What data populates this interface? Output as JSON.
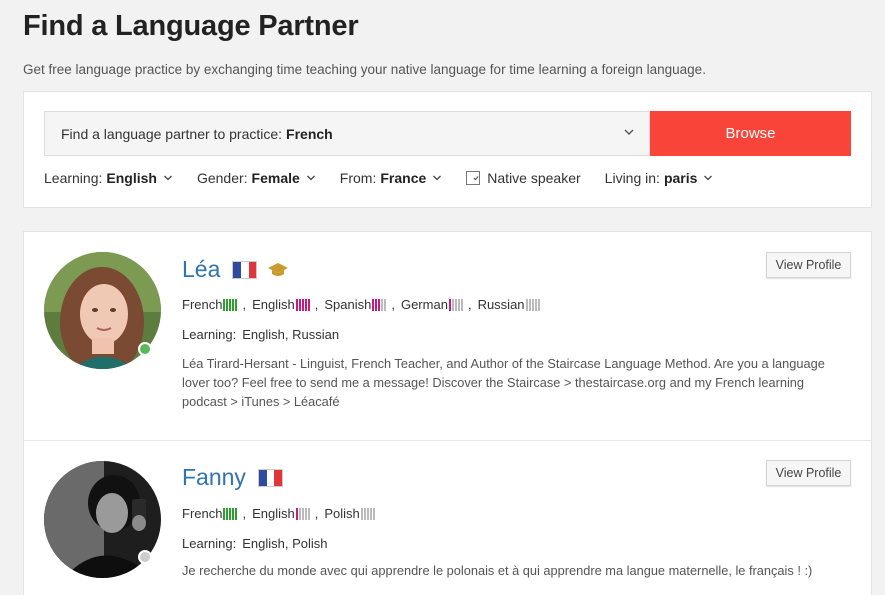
{
  "header": {
    "title": "Find a Language Partner",
    "subtitle": "Get free language practice by exchanging time teaching your native language for time learning a foreign language."
  },
  "search": {
    "prompt": "Find a language partner to practice:",
    "language": "French",
    "browse_label": "Browse"
  },
  "filters": {
    "learning_label": "Learning:",
    "learning_value": "English",
    "gender_label": "Gender:",
    "gender_value": "Female",
    "from_label": "From:",
    "from_value": "France",
    "native_label": "Native speaker",
    "native_checked": true,
    "living_label": "Living in:",
    "living_value": "paris"
  },
  "colors": {
    "accent": "#f94439",
    "link": "#2f74b3",
    "bar_native": "#2e9e2e",
    "bar_learning": "#c8197c",
    "bar_empty": "#bbbbbb",
    "online": "#5cb85c",
    "offline": "#cccccc"
  },
  "profiles": [
    {
      "name": "Léa",
      "flag": "france-flag",
      "badge_icon": "graduation-cap-icon",
      "status": "online",
      "view_label": "View Profile",
      "languages": [
        {
          "name": "French",
          "level": 5,
          "native": true
        },
        {
          "name": "English",
          "level": 5,
          "native": false
        },
        {
          "name": "Spanish",
          "level": 3,
          "native": false
        },
        {
          "name": "German",
          "level": 1,
          "native": false
        },
        {
          "name": "Russian",
          "level": 0,
          "native": false
        }
      ],
      "learning_label": "Learning:",
      "learning": "English,  Russian",
      "bio": "Léa Tirard-Hersant - Linguist, French Teacher, and Author of the Staircase Language Method. Are you a language lover too? Feel free to send me a message! Discover the Staircase > thestaircase.org and my French learning podcast > iTunes > Léacafé"
    },
    {
      "name": "Fanny",
      "flag": "france-flag",
      "status": "offline",
      "view_label": "View Profile",
      "languages": [
        {
          "name": "French",
          "level": 5,
          "native": true
        },
        {
          "name": "English",
          "level": 1,
          "native": false
        },
        {
          "name": "Polish",
          "level": 0,
          "native": false
        }
      ],
      "learning_label": "Learning:",
      "learning": "English,  Polish",
      "bio": "Je recherche du monde avec qui apprendre le polonais et à qui apprendre ma langue maternelle, le français ! :)"
    }
  ]
}
